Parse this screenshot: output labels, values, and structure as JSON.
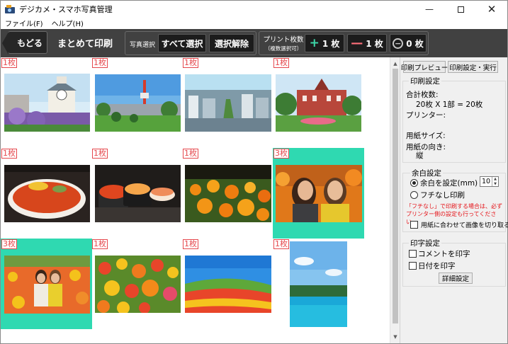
{
  "window": {
    "title": "デジカメ・スマホ写真管理",
    "controls": {
      "minimize": "—",
      "close": "✕"
    }
  },
  "menu": [
    "ファイル(F)",
    "ヘルプ(H)"
  ],
  "toolbar": {
    "back_label": "もどる",
    "page_title": "まとめて印刷",
    "photo_select_label": "写真選択",
    "select_all": "すべて選択",
    "deselect": "選択解除",
    "print_count_label": "プリント枚数",
    "print_count_sub": "（複数選択可）",
    "plus_symbol": "+",
    "plus_label": "1 枚",
    "minus_symbol": "—",
    "minus_label": "1 枚",
    "zero_symbol": "−",
    "zero_label": "0 枚"
  },
  "photos": [
    {
      "count": "1枚",
      "selected": false,
      "subject": "clock-tower"
    },
    {
      "count": "1枚",
      "selected": false,
      "subject": "tv-tower-park"
    },
    {
      "count": "1枚",
      "selected": false,
      "subject": "city-aerial"
    },
    {
      "count": "1枚",
      "selected": false,
      "subject": "red-brick-building"
    },
    {
      "count": "1枚",
      "selected": false,
      "subject": "ikura-bowl"
    },
    {
      "count": "1枚",
      "selected": false,
      "subject": "sushi"
    },
    {
      "count": "1枚",
      "selected": false,
      "subject": "orange-flower-field"
    },
    {
      "count": "3枚",
      "selected": true,
      "subject": "two-women-smiling"
    },
    {
      "count": "3枚",
      "selected": true,
      "subject": "women-in-flowers"
    },
    {
      "count": "1枚",
      "selected": false,
      "subject": "tulips"
    },
    {
      "count": "1枚",
      "selected": false,
      "subject": "flower-hill-sky"
    },
    {
      "count": "1枚",
      "selected": false,
      "subject": "blue-pond"
    }
  ],
  "panel": {
    "preview_button": "印刷プレビュー",
    "execute_button": "印刷設定・実行",
    "print_settings_legend": "印刷設定",
    "total_label": "合計枚数:",
    "total_value": "20枚 X 1部 = 20枚",
    "printer_label": "プリンター:",
    "paper_size_label": "用紙サイズ:",
    "orientation_label": "用紙の向き:",
    "orientation_value": "縦",
    "margin_legend": "余白設定",
    "margin_set_label": "余白を設定(mm)",
    "margin_value": "10",
    "borderless_label": "フチなし印刷",
    "warning_text": "「フチなし」で印刷する場合は、必ずプリンター側の設定も行ってください。",
    "fit_crop_label": "用紙に合わせて画像を切り取る",
    "imprint_legend": "印字設定",
    "print_comment_label": "コメントを印字",
    "print_date_label": "日付を印字",
    "detail_button": "詳細設定"
  },
  "colors": {
    "toolbar_bg": "#414141",
    "selection": "#2fd9b1",
    "count_badge": "#e5484d",
    "plus_accent": "#3dd6a8",
    "minus_accent": "#ff6f7a",
    "warning": "#e5151a"
  }
}
